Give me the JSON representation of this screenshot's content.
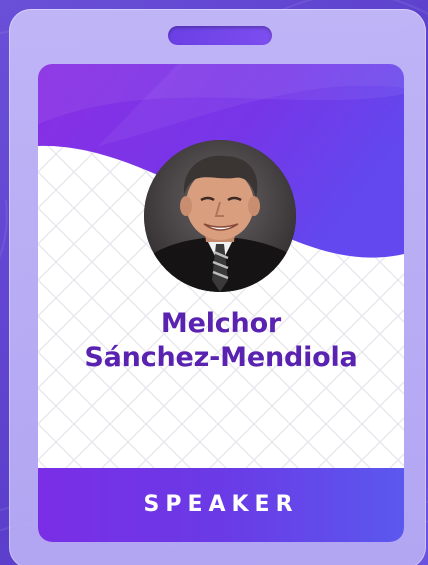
{
  "badge": {
    "name_line1": "Melchor",
    "name_line2": "Sánchez-Mendiola",
    "role": "SPEAKER",
    "photo_icon": "speaker-photo"
  },
  "colors": {
    "background": "#5b3fcc",
    "holder": "#c4baf8",
    "header": "#7b35e8",
    "name_text": "#5a22b0",
    "footer_start": "#7a2ee6",
    "footer_end": "#5b58ee",
    "role_text": "#ffffff"
  }
}
